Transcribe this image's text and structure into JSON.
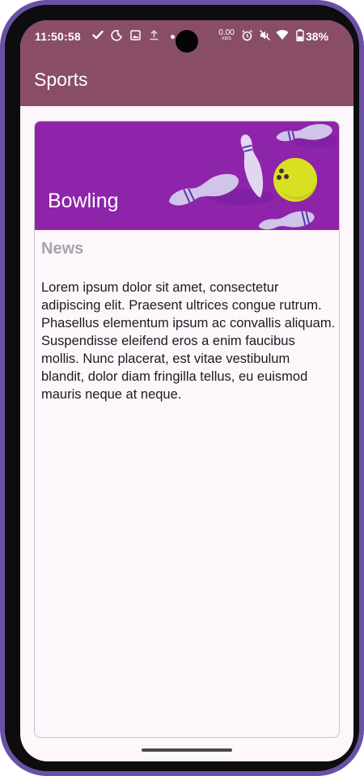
{
  "status_bar": {
    "time": "11:50:58",
    "left_icons": [
      "check-icon",
      "do-not-disturb-moon-icon",
      "image-icon",
      "upload-icon"
    ],
    "net_speed_value": "0.00",
    "net_speed_unit": "KB/S",
    "right_icons": [
      "alarm-icon",
      "mute-icon",
      "wifi-icon",
      "battery-icon"
    ],
    "battery_percent": "38%"
  },
  "app_bar": {
    "title": "Sports",
    "color": "#8a4d68"
  },
  "card": {
    "banner_title": "Bowling",
    "banner_color": "#8e24aa",
    "section_heading": "News",
    "body": "Lorem ipsum dolor sit amet, consectetur adipiscing elit. Praesent ultrices congue rutrum. Phasellus elementum ipsum ac convallis aliquam. Suspendisse eleifend eros a enim faucibus mollis. Nunc placerat, est vitae vestibulum blandit, dolor diam fringilla tellus, eu euismod mauris neque at neque."
  },
  "colors": {
    "device_frame": "#6a51a6",
    "screen_background": "#fdf7fb",
    "ball": "#d9e021"
  }
}
